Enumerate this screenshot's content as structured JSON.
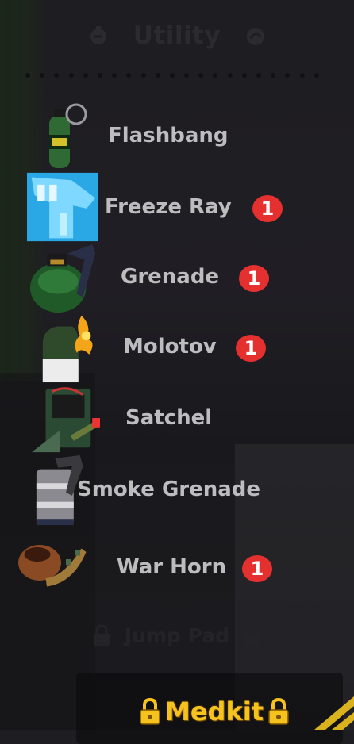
{
  "header": {
    "title": "Utility"
  },
  "items": [
    {
      "label": "Flashbang",
      "badge": ""
    },
    {
      "label": "Freeze Ray",
      "badge": "1"
    },
    {
      "label": "Grenade",
      "badge": "1"
    },
    {
      "label": "Molotov",
      "badge": "1"
    },
    {
      "label": "Satchel",
      "badge": ""
    },
    {
      "label": "Smoke Grenade",
      "badge": ""
    },
    {
      "label": "War Horn",
      "badge": "1"
    }
  ],
  "locked_item": {
    "label": "Jump Pad",
    "icon": "lock-icon"
  },
  "featured_item": {
    "label": "Medkit",
    "icon": "gold-lock-icon"
  },
  "colors": {
    "badge": "#e53030",
    "label": "#bdbdc0",
    "gold": "#f6c21d"
  }
}
